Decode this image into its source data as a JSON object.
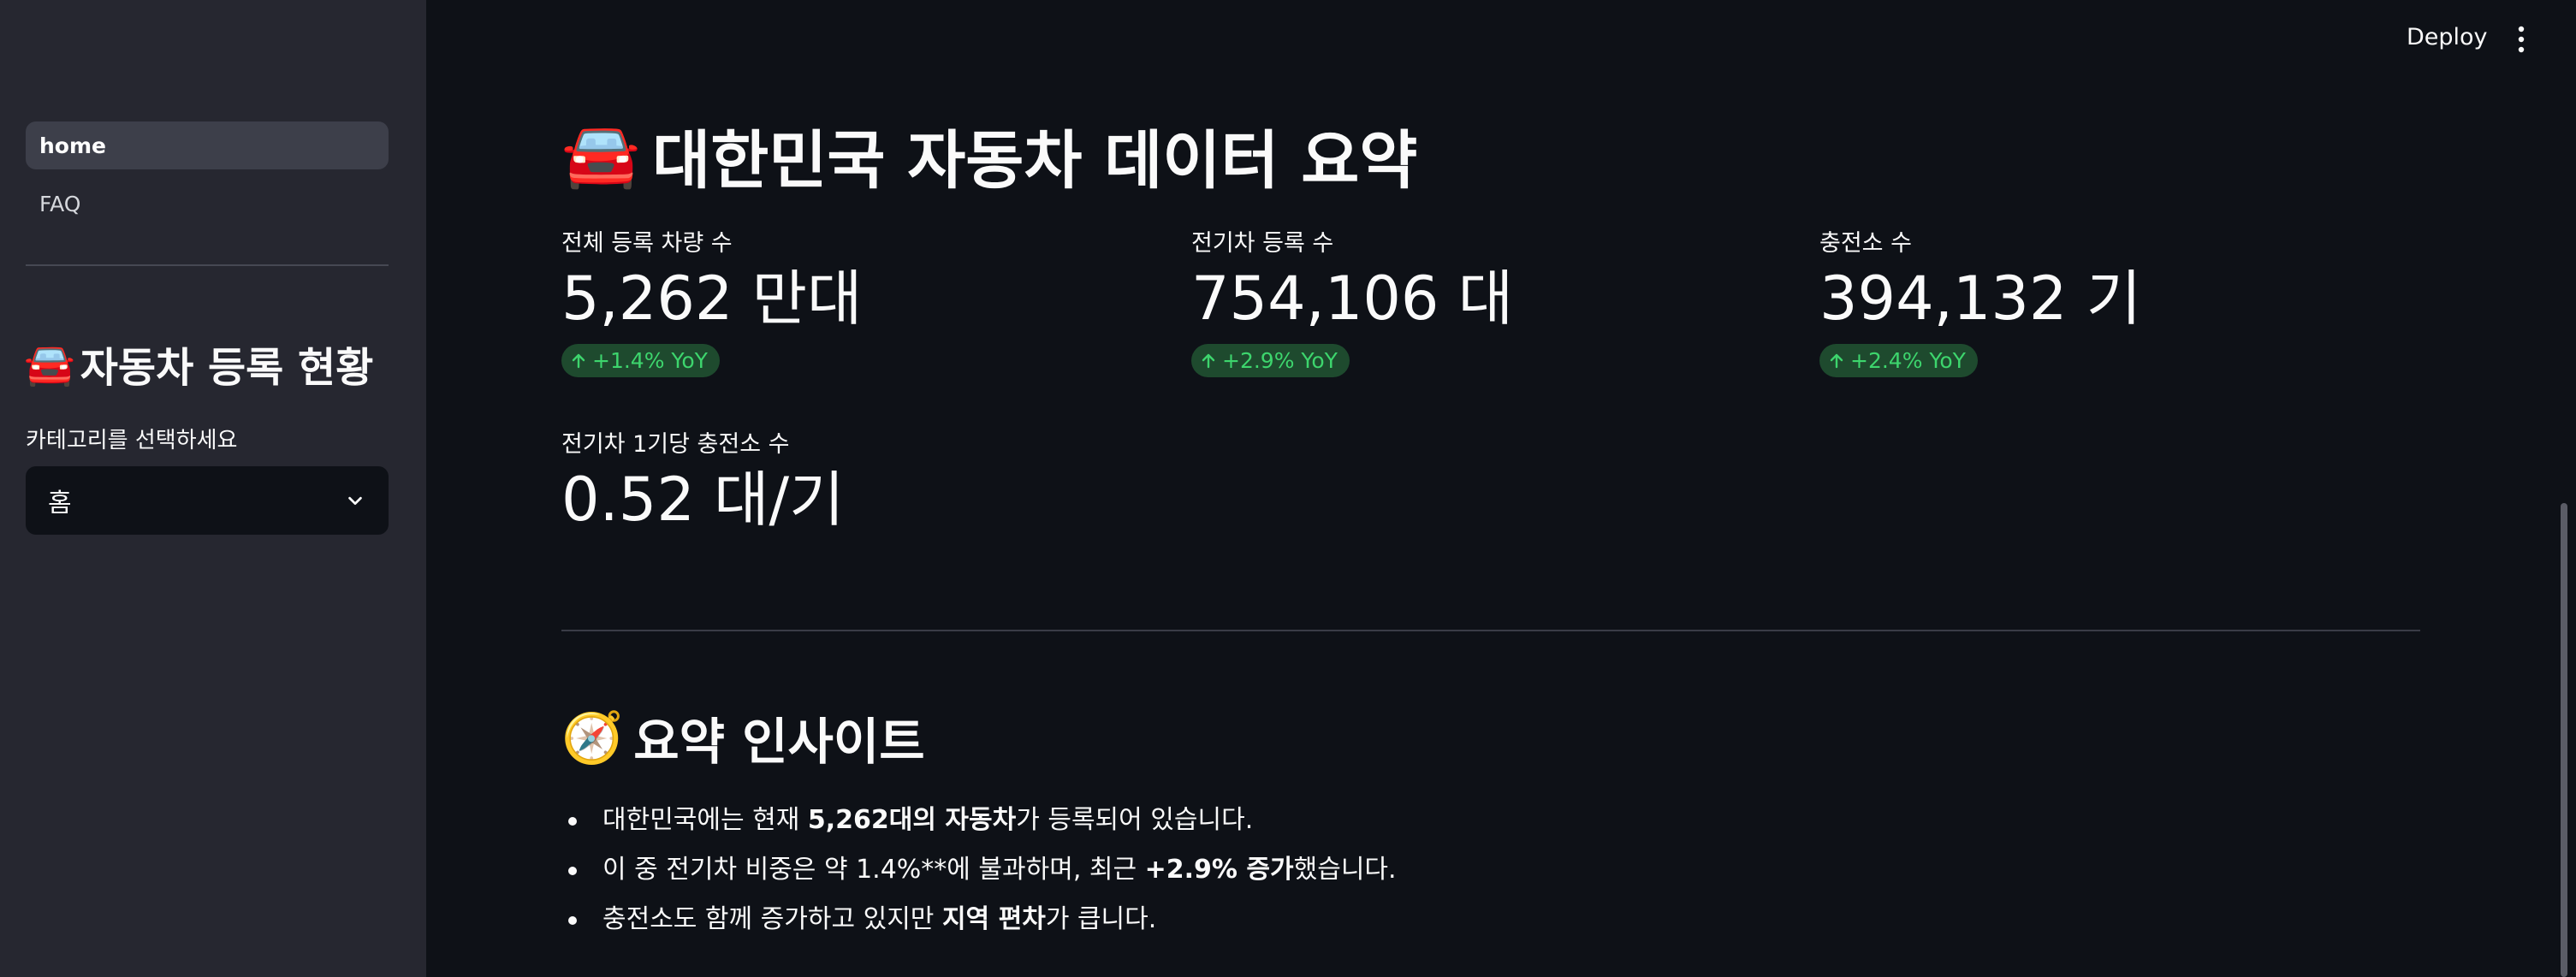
{
  "header": {
    "deploy_label": "Deploy",
    "menu_icon": "kebab-menu-icon"
  },
  "sidebar": {
    "nav": [
      {
        "label": "home",
        "active": true
      },
      {
        "label": "FAQ",
        "active": false
      }
    ],
    "title_icon": "🚘",
    "title": "자동차 등록 현황",
    "select_label": "카테고리를 선택하세요",
    "select_value": "홈"
  },
  "main": {
    "title_icon": "🚘",
    "title": "대한민국 자동차 데이터 요약",
    "metrics": [
      {
        "label": "전체 등록 차량 수",
        "value": "5,262 만대",
        "delta": "+1.4% YoY"
      },
      {
        "label": "전기차 등록 수",
        "value": "754,106 대",
        "delta": "+2.9% YoY"
      },
      {
        "label": "충전소 수",
        "value": "394,132 기",
        "delta": "+2.4% YoY"
      },
      {
        "label": "전기차 1기당 충전소 수",
        "value": "0.52 대/기"
      }
    ],
    "insights_icon": "🧭",
    "insights_title": "요약 인사이트",
    "insights": [
      {
        "pre": "대한민국에는 현재 ",
        "bold": "5,262대의 자동차",
        "post": "가 등록되어 있습니다."
      },
      {
        "pre": "이 중 전기차 비중은 약 1.4%**에 불과하며, 최근 ",
        "bold": "+2.9% 증가",
        "post": "했습니다."
      },
      {
        "pre": "충전소도 함께 증가하고 있지만 ",
        "bold": "지역 편차",
        "post": "가 큽니다."
      }
    ]
  },
  "colors": {
    "background": "#0e1117",
    "sidebar": "#262730",
    "delta_positive": "#3dd56d"
  }
}
